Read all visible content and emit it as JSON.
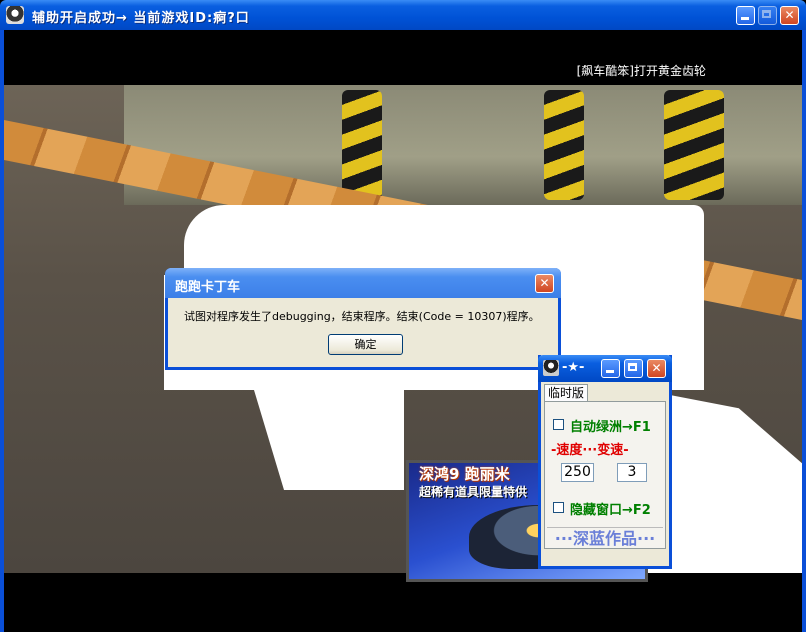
{
  "window": {
    "title": "辅助开启成功→  当前游戏ID:痾?口"
  },
  "game": {
    "message": "[飙车酷笨]打开黄金齿轮"
  },
  "ad": {
    "line1": "深鸿9 跑丽米",
    "line2": "超稀有道具限量特供"
  },
  "error_dialog": {
    "title": "跑跑卡丁车",
    "message": "试图对程序发生了debugging，结束程序。结束(Code = 10307)程序。",
    "ok_label": "确定"
  },
  "tool": {
    "title": "-★-",
    "tab": "临时版",
    "auto_label": "自动绿洲→F1",
    "speed_label": "-速度···变速-",
    "speed_value": "250",
    "shift_value": "3",
    "hide_label": "隐藏窗口→F2",
    "signature": "···深蓝作品···"
  },
  "colors": {
    "titlebar_blue": "#0052d6",
    "dialog_face": "#ece9d8",
    "label_green": "#008000",
    "label_red": "#e00000",
    "signature_blue": "#6a7fd8"
  },
  "icons": [
    "app-icon",
    "minimize-icon",
    "maximize-icon",
    "close-icon"
  ]
}
